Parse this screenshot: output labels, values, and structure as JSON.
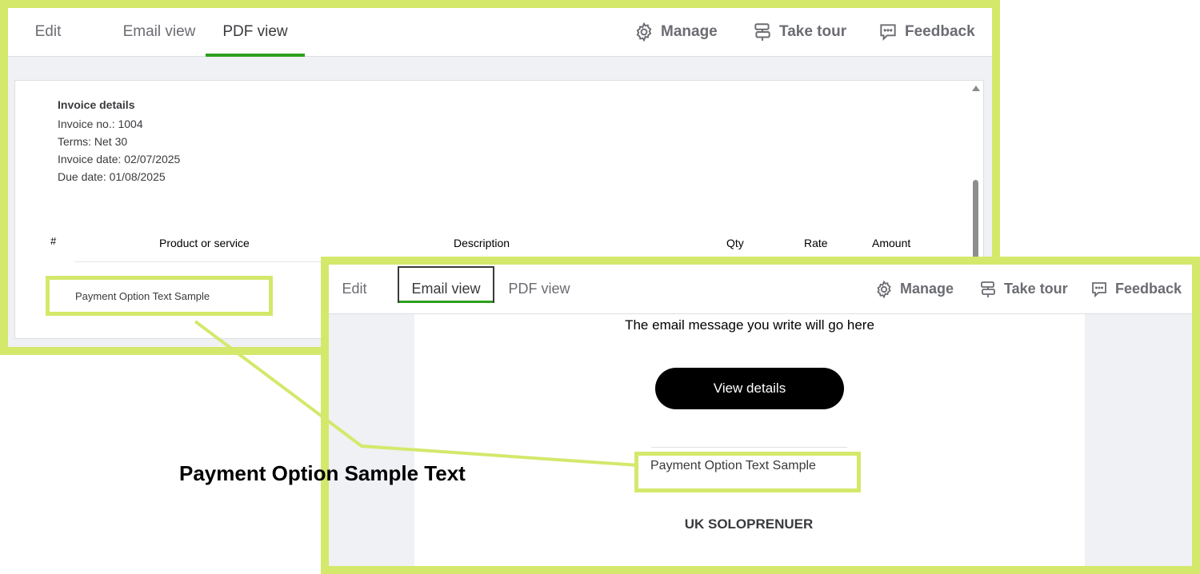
{
  "pdf_panel": {
    "tabs": [
      {
        "label": "Edit"
      },
      {
        "label": "Email view"
      },
      {
        "label": "PDF view",
        "active": true
      }
    ],
    "actions": {
      "manage": "Manage",
      "take_tour": "Take tour",
      "feedback": "Feedback"
    },
    "invoice": {
      "heading": "Invoice details",
      "number": "Invoice no.: 1004",
      "terms": "Terms: Net 30",
      "invoice_date": "Invoice date: 02/07/2025",
      "due_date": "Due date: 01/08/2025"
    },
    "table_headers": {
      "index": "#",
      "product": "Product or service",
      "description": "Description",
      "qty": "Qty",
      "rate": "Rate",
      "amount": "Amount"
    },
    "payment_option": "Payment Option Text Sample"
  },
  "email_panel": {
    "tabs": [
      {
        "label": "Edit"
      },
      {
        "label": "Email view",
        "active": true
      },
      {
        "label": "PDF view"
      }
    ],
    "actions": {
      "manage": "Manage",
      "take_tour": "Take tour",
      "feedback": "Feedback"
    },
    "message": "The email message you write will go here",
    "view_button": "View details",
    "payment_option": "Payment Option Text Sample",
    "company": "UK SOLOPRENUER"
  },
  "annotation": {
    "label": "Payment Option Sample Text"
  },
  "colors": {
    "highlight": "#d4e86b",
    "active_tab": "#2ca01c",
    "button": "#000000"
  }
}
